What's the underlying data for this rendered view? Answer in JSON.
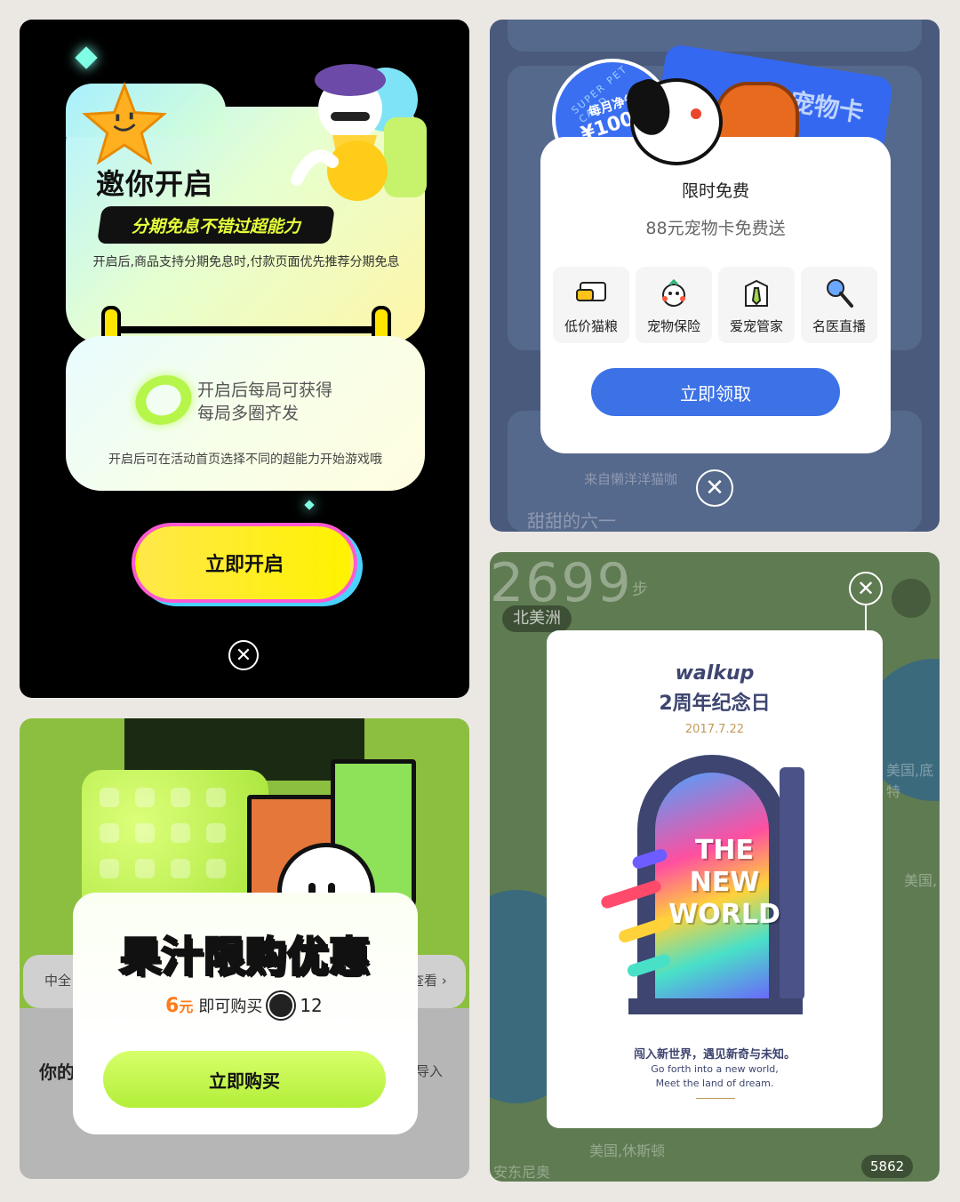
{
  "panel1": {
    "title": "邀你开启",
    "banner": "分期免息不错过超能力",
    "description": "开启后,商品支持分期免息时,付款页面优先推荐分期免息",
    "gain_line1": "开启后每局可获得",
    "gain_line2": "每局多圈齐发",
    "note": "开启后可在活动首页选择不同的超能力开始游戏哦",
    "cta": "立即开启",
    "close_glyph": "✕"
  },
  "panel2": {
    "badge_top": "SUPER PET CARD",
    "badge_save": "每月净省",
    "badge_amount": "¥100",
    "card_text": "超级宠物卡",
    "title": "限时免费",
    "subtitle": "88元宠物卡免费送",
    "features": [
      {
        "label": "低价猫粮",
        "icon": "cat-food-card-icon"
      },
      {
        "label": "宠物保险",
        "icon": "pet-insurance-icon"
      },
      {
        "label": "爱宠管家",
        "icon": "pet-butler-icon"
      },
      {
        "label": "名医直播",
        "icon": "vet-live-icon"
      }
    ],
    "cta": "立即领取",
    "bg_text_bottom": "甜甜的六一",
    "bg_text_from": "来自懒洋洋猫咖",
    "close_glyph": "✕"
  },
  "panel3": {
    "title": "果汁限购优惠",
    "price_value": "6",
    "price_unit": "元",
    "price_suffix": "即可购买",
    "coin_count": "12",
    "cta": "立即购买",
    "bg_left_small": "中全",
    "bg_right_small": "查看 ›",
    "bg_left_big": "你的",
    "bg_right_btn": "导入"
  },
  "panel4": {
    "steps_bg": "2699",
    "steps_unit": "步",
    "region_pill": "北美洲",
    "logo": "walkup",
    "anniversary": "2周年纪念日",
    "date": "2017.7.22",
    "art_line1": "THE",
    "art_line2": "NEW",
    "art_line3": "WORLD",
    "cn_slogan": "闯入新世界，遇见新奇与未知。",
    "en_line1": "Go forth into a new world,",
    "en_line2": "Meet the land of dream.",
    "map_label1": "美国,底特",
    "map_label2": "美国,",
    "map_label3": "美国,休斯顿",
    "map_label4": "安东尼奥",
    "step_count": "5862",
    "close_glyph": "✕"
  }
}
